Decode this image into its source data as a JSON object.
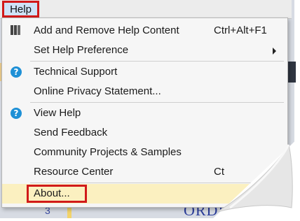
{
  "menubar": {
    "help_label": "Help"
  },
  "menu": {
    "items": [
      {
        "label": "Add and Remove Help Content",
        "shortcut": "Ctrl+Alt+F1"
      },
      {
        "label": "Set Help Preference"
      },
      {
        "label": "Technical Support"
      },
      {
        "label": "Online Privacy Statement..."
      },
      {
        "label": "View Help"
      },
      {
        "label": "Send Feedback"
      },
      {
        "label": "Community Projects & Samples"
      },
      {
        "label": "Resource Center",
        "shortcut": "Ct"
      },
      {
        "label": "About..."
      }
    ]
  },
  "background": {
    "partial_text": "ORDE",
    "partial_mark": "3"
  },
  "colors": {
    "highlight_border": "#d11a1a",
    "help_icon": "#1e90d6",
    "about_bg": "#fbf0c0"
  },
  "icons": {
    "add_remove": "books-icon",
    "support": "help-circle-icon",
    "view_help": "help-circle-icon",
    "submenu": "chevron-right-icon"
  }
}
